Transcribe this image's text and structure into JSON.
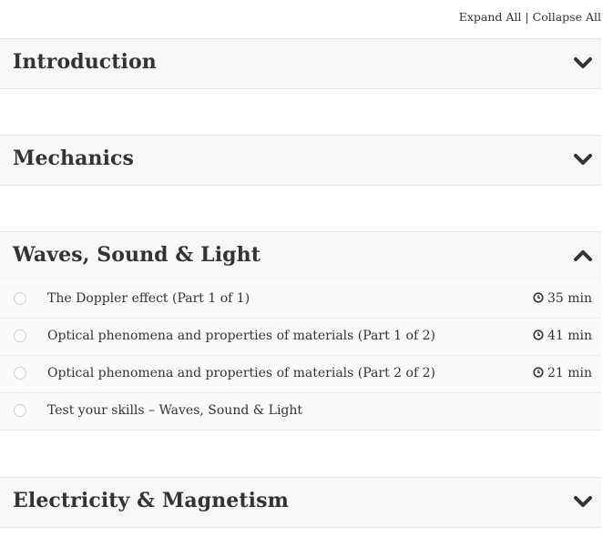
{
  "controls": {
    "expand_all": "Expand All",
    "separator": "|",
    "collapse_all": "Collapse All"
  },
  "sections": [
    {
      "title": "Introduction",
      "state": "collapsed"
    },
    {
      "title": "Mechanics",
      "state": "collapsed"
    },
    {
      "title": "Waves, Sound & Light",
      "state": "expanded",
      "lessons": [
        {
          "title": "The Doppler effect (Part 1 of 1)",
          "duration": "35 min"
        },
        {
          "title": "Optical phenomena and properties of materials (Part 1 of 2)",
          "duration": "41 min"
        },
        {
          "title": "Optical phenomena and properties of materials (Part 2 of 2)",
          "duration": "21 min"
        },
        {
          "title": "Test your skills – Waves, Sound & Light",
          "duration": ""
        }
      ]
    },
    {
      "title": "Electricity & Magnetism",
      "state": "collapsed"
    }
  ],
  "icons": {
    "collapsed": "chevron-down-icon",
    "expanded": "chevron-up-icon",
    "duration": "clock-icon",
    "lesson_status": "radio-circle-icon"
  }
}
